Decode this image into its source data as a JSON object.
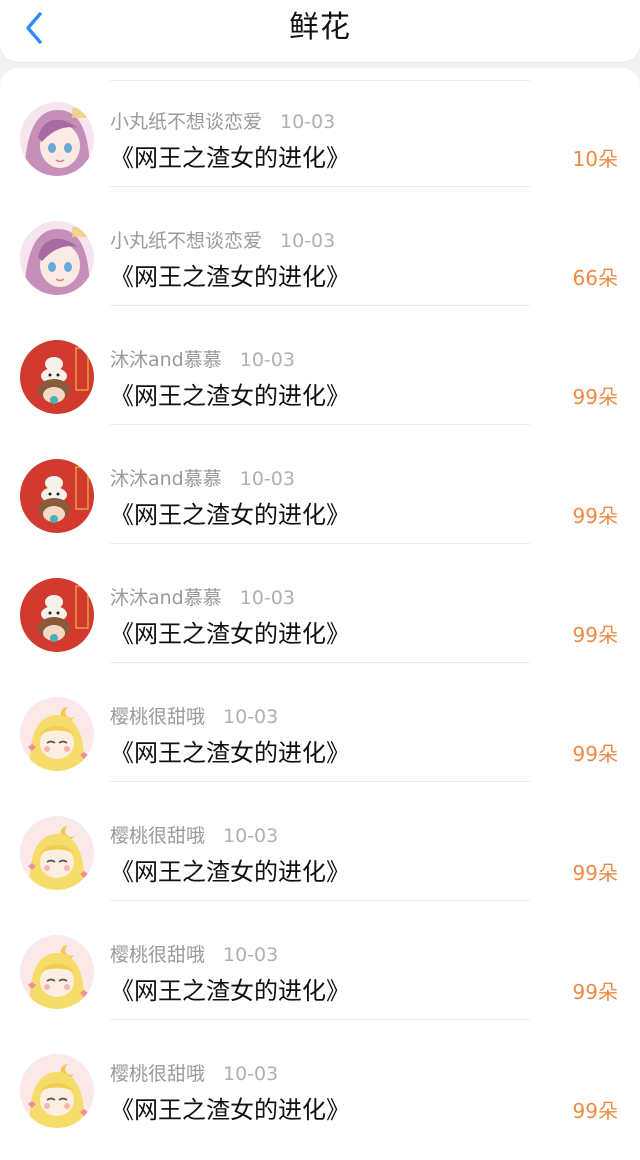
{
  "header": {
    "title": "鲜花",
    "back_icon": "chevron-left-icon",
    "accent_color": "#2f8cff"
  },
  "list": [
    {
      "avatar": "anime-girl-avatar",
      "user": "小丸纸不想谈恋爱",
      "date": "10-03",
      "book": "《网王之渣女的进化》",
      "flowers": "10朵"
    },
    {
      "avatar": "anime-girl-avatar",
      "user": "小丸纸不想谈恋爱",
      "date": "10-03",
      "book": "《网王之渣女的进化》",
      "flowers": "66朵"
    },
    {
      "avatar": "red-cartoon-avatar",
      "user": "沐沐and慕慕",
      "date": "10-03",
      "book": "《网王之渣女的进化》",
      "flowers": "99朵"
    },
    {
      "avatar": "red-cartoon-avatar",
      "user": "沐沐and慕慕",
      "date": "10-03",
      "book": "《网王之渣女的进化》",
      "flowers": "99朵"
    },
    {
      "avatar": "red-cartoon-avatar",
      "user": "沐沐and慕慕",
      "date": "10-03",
      "book": "《网王之渣女的进化》",
      "flowers": "99朵"
    },
    {
      "avatar": "sailor-moon-avatar",
      "user": "樱桃很甜哦",
      "date": "10-03",
      "book": "《网王之渣女的进化》",
      "flowers": "99朵"
    },
    {
      "avatar": "sailor-moon-avatar",
      "user": "樱桃很甜哦",
      "date": "10-03",
      "book": "《网王之渣女的进化》",
      "flowers": "99朵"
    },
    {
      "avatar": "sailor-moon-avatar",
      "user": "樱桃很甜哦",
      "date": "10-03",
      "book": "《网王之渣女的进化》",
      "flowers": "99朵"
    },
    {
      "avatar": "sailor-moon-avatar",
      "user": "樱桃很甜哦",
      "date": "10-03",
      "book": "《网王之渣女的进化》",
      "flowers": "99朵"
    }
  ],
  "colors": {
    "flowers": "#ef8a45",
    "username": "#9a9a9a",
    "separator": "#ececec"
  }
}
